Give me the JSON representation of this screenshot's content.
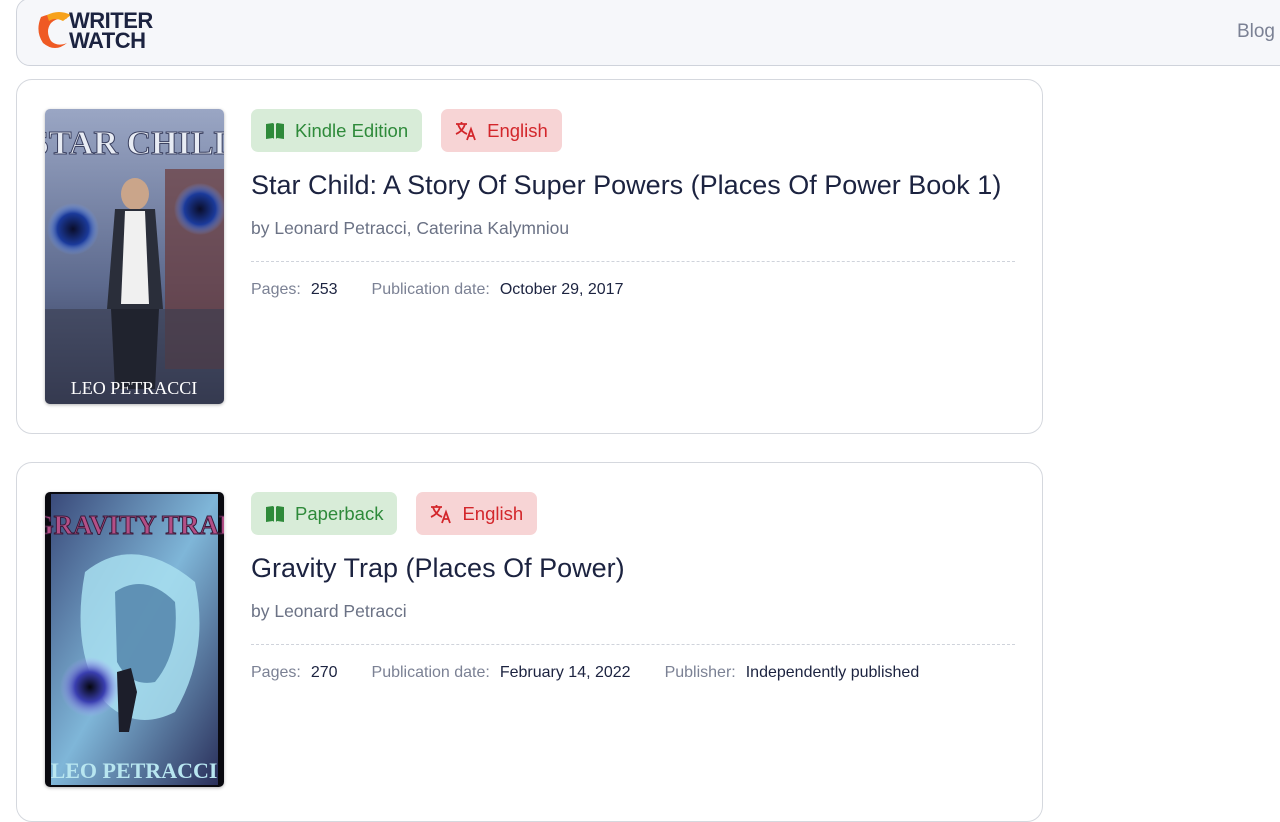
{
  "header": {
    "logo_line1": "WRITER",
    "logo_line2": "WATCH",
    "nav_blog": "Blog"
  },
  "books": [
    {
      "format": "Kindle Edition",
      "language": "English",
      "title": "Star Child: A Story Of Super Powers (Places Of Power Book 1)",
      "authors": "by Leonard Petracci, Caterina Kalymniou",
      "pages_label": "Pages:",
      "pages": "253",
      "pubdate_label": "Publication date:",
      "pubdate": "October 29, 2017",
      "cover_title_top": "STAR CHILD",
      "cover_author": "LEO PETRACCI"
    },
    {
      "format": "Paperback",
      "language": "English",
      "title": "Gravity Trap (Places Of Power)",
      "authors": "by Leonard Petracci",
      "pages_label": "Pages:",
      "pages": "270",
      "pubdate_label": "Publication date:",
      "pubdate": "February 14, 2022",
      "publisher_label": "Publisher:",
      "publisher": "Independently published",
      "cover_title_top": "GRAVITY TRAP",
      "cover_author": "LEO PETRACCI"
    }
  ],
  "icons": {
    "format": "book-open-icon",
    "language": "translate-icon"
  },
  "colors": {
    "format_badge_bg": "#d8ecd8",
    "format_badge_text": "#2e8a3a",
    "language_badge_bg": "#f7d4d5",
    "language_badge_text": "#d3262b"
  }
}
